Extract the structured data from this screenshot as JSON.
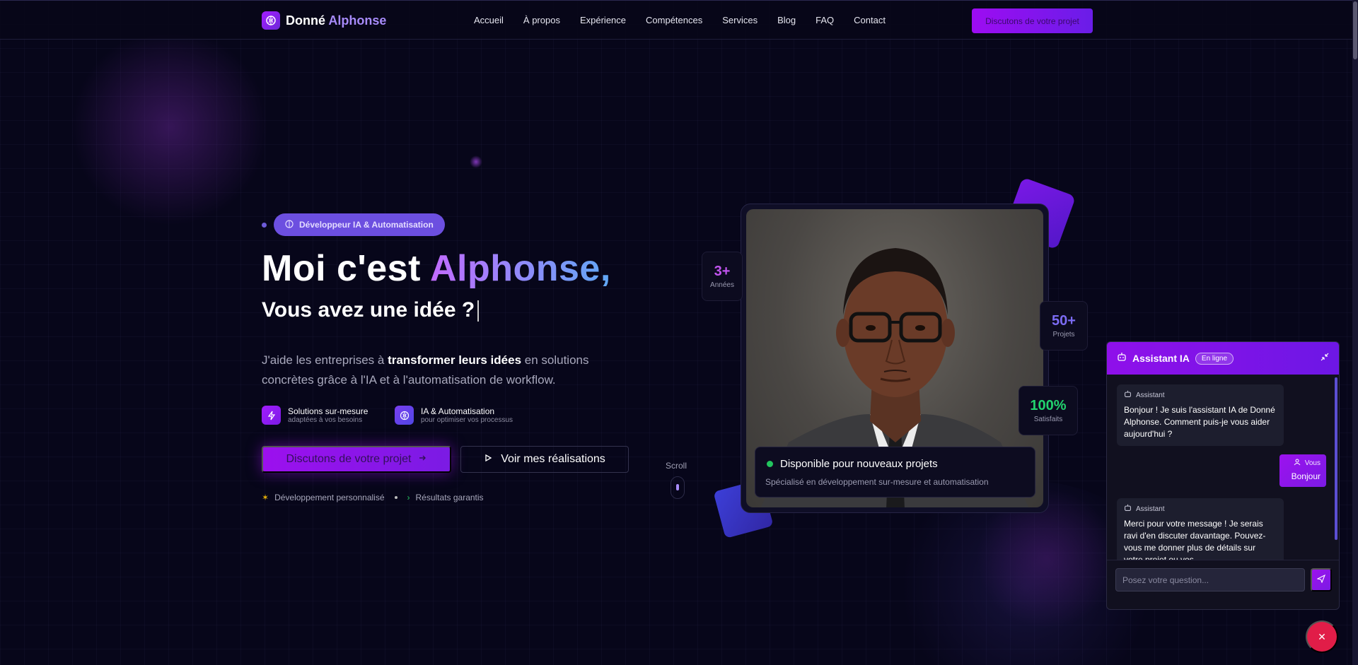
{
  "nav": {
    "logo_first": "Donné",
    "logo_accent": "Alphonse",
    "links": [
      "Accueil",
      "À propos",
      "Expérience",
      "Compétences",
      "Services",
      "Blog",
      "FAQ",
      "Contact"
    ],
    "cta": "Discutons de votre projet"
  },
  "hero": {
    "badge": "Développeur IA & Automatisation",
    "title_plain": "Moi c'est ",
    "title_accent": "Alphonse,",
    "subtitle": "Vous avez une idée ?",
    "lead_pre": "J'aide les entreprises à ",
    "lead_bold": "transformer leurs idées",
    "lead_post": " en solutions concrètes grâce à l'IA et à l'automatisation de workflow.",
    "features": [
      {
        "title": "Solutions sur-mesure",
        "sub": "adaptées à vos besoins"
      },
      {
        "title": "IA & Automatisation",
        "sub": "pour optimiser vos processus"
      }
    ],
    "btn_primary": "Discutons de votre projet",
    "btn_secondary": "Voir mes réalisations",
    "tag1": "Développement personnalisé",
    "tag2": "Résultats garantis",
    "scroll": "Scroll"
  },
  "stats": [
    {
      "num": "3+",
      "label": "Années"
    },
    {
      "num": "50+",
      "label": "Projets"
    },
    {
      "num": "100%",
      "label": "Satisfaits"
    }
  ],
  "availability": {
    "title": "Disponible pour nouveaux projets",
    "sub": "Spécialisé en développement sur-mesure et automatisation"
  },
  "chat": {
    "title": "Assistant IA",
    "status": "En ligne",
    "messages": [
      {
        "role": "Assistant",
        "text": "Bonjour ! Je suis l'assistant IA de Donné Alphonse. Comment puis-je vous aider aujourd'hui ?"
      },
      {
        "role": "Vous",
        "text": "Bonjour"
      },
      {
        "role": "Assistant",
        "text": "Merci pour votre message ! Je serais ravi d'en discuter davantage. Pouvez-vous me donner plus de détails sur votre projet ou vos"
      }
    ],
    "placeholder": "Posez votre question..."
  },
  "colors": {
    "background": "#07061a",
    "accent_purple": "#9c10ee",
    "accent_blue": "#60a8f5",
    "online_green": "#22c55e",
    "close_red": "#e11d48"
  }
}
